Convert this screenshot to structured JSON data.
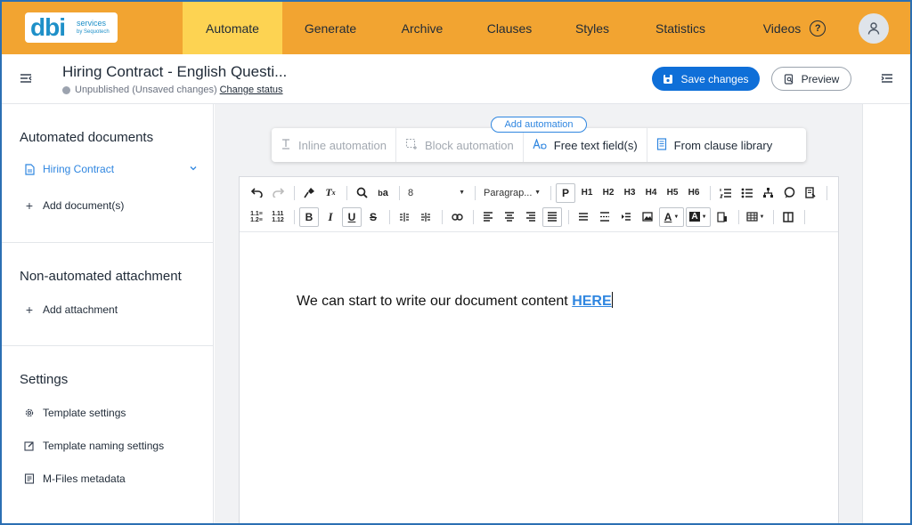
{
  "nav": {
    "logo": {
      "main": "dbi",
      "line1": "services",
      "line2": "by Sequotech"
    },
    "tabs": [
      "Automate",
      "Generate",
      "Archive",
      "Clauses",
      "Styles",
      "Statistics",
      "Videos"
    ],
    "active_tab": "Automate",
    "help_glyph": "?"
  },
  "header": {
    "title": "Hiring Contract - English Questi...",
    "status": "Unpublished",
    "unsaved": "(Unsaved changes)",
    "change_status": "Change status",
    "save_label": "Save changes",
    "preview_label": "Preview"
  },
  "sidebar": {
    "automated_title": "Automated documents",
    "document": "Hiring Contract",
    "add_document": "Add document(s)",
    "attachment_title": "Non-automated attachment",
    "add_attachment": "Add attachment",
    "settings_title": "Settings",
    "settings_items": [
      "Template settings",
      "Template naming settings",
      "M-Files metadata"
    ]
  },
  "automation": {
    "add_label": "Add automation",
    "buttons": [
      "Inline automation",
      "Block automation",
      "Free text field(s)",
      "From clause library"
    ]
  },
  "toolbar": {
    "font_size": "8",
    "paragraph": "Paragrap...",
    "headings": [
      "P",
      "H1",
      "H2",
      "H3",
      "H4",
      "H5",
      "H6"
    ]
  },
  "editor": {
    "text": "We can start to write our document content ",
    "highlight": "HERE"
  },
  "colors": {
    "nav_bg": "#f2a431",
    "active_tab": "#fdd352",
    "primary": "#0f6fd8",
    "link": "#2f86e0"
  }
}
